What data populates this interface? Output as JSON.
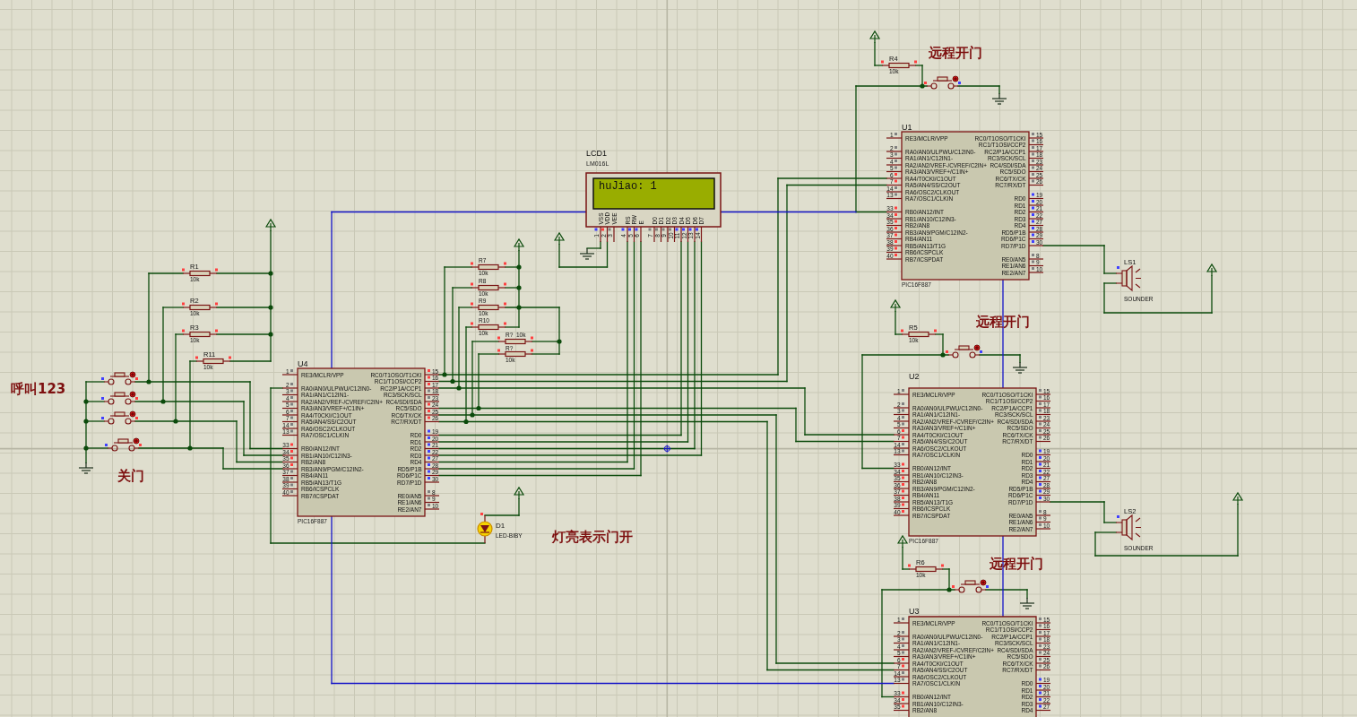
{
  "notes": [
    {
      "text": "远程开门"
    },
    {
      "text": "远程开门"
    },
    {
      "text": "呼叫123"
    },
    {
      "text": "关门"
    },
    {
      "text": "灯亮表示门开"
    },
    {
      "text": "远程开门"
    }
  ],
  "lcd": {
    "ref": "LCD1",
    "model": "LM016L",
    "display": "huJiao: 1",
    "pins": [
      {
        "name": "VSS",
        "number": "1",
        "color": "#4040ff"
      },
      {
        "name": "VDD",
        "number": "2",
        "color": "#ff4040"
      },
      {
        "name": "VEE",
        "number": "3",
        "color": "#808080"
      },
      {
        "name": "RS",
        "number": "4",
        "color": "#4040ff"
      },
      {
        "name": "RW",
        "number": "5",
        "color": "#4040ff"
      },
      {
        "name": "E",
        "number": "6",
        "color": "#4040ff"
      },
      {
        "name": "D0",
        "number": "7",
        "color": "#808080"
      },
      {
        "name": "D1",
        "number": "8",
        "color": "#808080"
      },
      {
        "name": "D2",
        "number": "9",
        "color": "#808080"
      },
      {
        "name": "D3",
        "number": "10",
        "color": "#808080"
      },
      {
        "name": "D4",
        "number": "11",
        "color": "#4040ff"
      },
      {
        "name": "D5",
        "number": "12",
        "color": "#4040ff"
      },
      {
        "name": "D6",
        "number": "13",
        "color": "#4040ff"
      },
      {
        "name": "D7",
        "number": "14",
        "color": "#4040ff"
      }
    ]
  },
  "chips": [
    {
      "ref": "U4",
      "model": "PIC16F887",
      "left_pins": [
        {
          "number": "1",
          "label": "RE3/MCLR/VPP",
          "color": "#808080"
        },
        {
          "number": "2",
          "label": "RA0/AN0/ULPWU/C12IN0-",
          "color": "#808080"
        },
        {
          "number": "3",
          "label": "RA1/AN1/C12IN1-",
          "color": "#808080"
        },
        {
          "number": "4",
          "label": "RA2/AN2/VREF-/CVREF/C2IN+",
          "color": "#808080"
        },
        {
          "number": "5",
          "label": "RA3/AN3/VREF+/C1IN+",
          "color": "#808080"
        },
        {
          "number": "6",
          "label": "RA4/T0CKI/C1OUT",
          "color": "#808080"
        },
        {
          "number": "7",
          "label": "RA5/AN4/SS/C2OUT",
          "color": "#808080"
        },
        {
          "number": "14",
          "label": "RA6/OSC2/CLKOUT",
          "color": "#808080"
        },
        {
          "number": "13",
          "label": "RA7/OSC1/CLKIN",
          "color": "#808080"
        },
        {
          "number": "33",
          "label": "RB0/AN12/INT",
          "color": "#ff4040"
        },
        {
          "number": "34",
          "label": "RB1/AN10/C12IN3-",
          "color": "#ff4040"
        },
        {
          "number": "35",
          "label": "RB2/AN8",
          "color": "#ff4040"
        },
        {
          "number": "36",
          "label": "RB3/AN9/PGM/C12IN2-",
          "color": "#ff4040"
        },
        {
          "number": "37",
          "label": "RB4/AN11",
          "color": "#808080"
        },
        {
          "number": "38",
          "label": "RB5/AN13/T1G",
          "color": "#808080"
        },
        {
          "number": "39",
          "label": "RB6/ICSPCLK",
          "color": "#808080"
        },
        {
          "number": "40",
          "label": "RB7/ICSPDAT",
          "color": "#808080"
        }
      ],
      "right_pins": [
        {
          "number": "15",
          "label": "RC0/T1OSO/T1CKI",
          "color": "#ff4040"
        },
        {
          "number": "16",
          "label": "RC1/T1OSI/CCP2",
          "color": "#ff4040"
        },
        {
          "number": "17",
          "label": "RC2/P1A/CCP1",
          "color": "#ff4040"
        },
        {
          "number": "18",
          "label": "RC3/SCK/SCL",
          "color": "#808080"
        },
        {
          "number": "23",
          "label": "RC4/SDI/SDA",
          "color": "#808080"
        },
        {
          "number": "24",
          "label": "RC5/SDO",
          "color": "#ff4040"
        },
        {
          "number": "25",
          "label": "RC6/TX/CK",
          "color": "#ff4040"
        },
        {
          "number": "26",
          "label": "RC7/RX/DT",
          "color": "#ff4040"
        },
        {
          "number": "19",
          "label": "RD0",
          "color": "#4040ff"
        },
        {
          "number": "20",
          "label": "RD1",
          "color": "#4040ff"
        },
        {
          "number": "21",
          "label": "RD2",
          "color": "#4040ff"
        },
        {
          "number": "22",
          "label": "RD3",
          "color": "#4040ff"
        },
        {
          "number": "27",
          "label": "RD4",
          "color": "#4040ff"
        },
        {
          "number": "28",
          "label": "RD5/P1B",
          "color": "#4040ff"
        },
        {
          "number": "29",
          "label": "RD6/P1C",
          "color": "#4040ff"
        },
        {
          "number": "30",
          "label": "RD7/P1D",
          "color": "#4040ff"
        },
        {
          "number": "8",
          "label": "RE0/AN5",
          "color": "#808080"
        },
        {
          "number": "9",
          "label": "RE1/AN6",
          "color": "#808080"
        },
        {
          "number": "10",
          "label": "RE2/AN7",
          "color": "#808080"
        }
      ]
    },
    {
      "ref": "U1",
      "model": "PIC16F887",
      "left_pins": [
        {
          "number": "1",
          "label": "RE3/MCLR/VPP",
          "color": "#808080"
        },
        {
          "number": "2",
          "label": "RA0/AN0/ULPWU/C12IN0-",
          "color": "#808080"
        },
        {
          "number": "3",
          "label": "RA1/AN1/C12IN1-",
          "color": "#808080"
        },
        {
          "number": "4",
          "label": "RA2/AN2/VREF-/CVREF/C2IN+",
          "color": "#808080"
        },
        {
          "number": "5",
          "label": "RA3/AN3/VREF+/C1IN+",
          "color": "#808080"
        },
        {
          "number": "6",
          "label": "RA4/T0CKI/C1OUT",
          "color": "#ff4040"
        },
        {
          "number": "7",
          "label": "RA5/AN4/SS/C2OUT",
          "color": "#ff4040"
        },
        {
          "number": "14",
          "label": "RA6/OSC2/CLKOUT",
          "color": "#808080"
        },
        {
          "number": "13",
          "label": "RA7/OSC1/CLKIN",
          "color": "#808080"
        },
        {
          "number": "33",
          "label": "RB0/AN12/INT",
          "color": "#ff4040"
        },
        {
          "number": "34",
          "label": "RB1/AN10/C12IN3-",
          "color": "#ff4040"
        },
        {
          "number": "35",
          "label": "RB2/AN8",
          "color": "#ff4040"
        },
        {
          "number": "36",
          "label": "RB3/AN9/PGM/C12IN2-",
          "color": "#ff4040"
        },
        {
          "number": "37",
          "label": "RB4/AN11",
          "color": "#ff4040"
        },
        {
          "number": "38",
          "label": "RB5/AN13/T1G",
          "color": "#ff4040"
        },
        {
          "number": "39",
          "label": "RB6/ICSPCLK",
          "color": "#ff4040"
        },
        {
          "number": "40",
          "label": "RB7/ICSPDAT",
          "color": "#ff4040"
        }
      ],
      "right_pins": [
        {
          "number": "15",
          "label": "RC0/T1OSO/T1CKI",
          "color": "#808080"
        },
        {
          "number": "16",
          "label": "RC1/T1OSI/CCP2",
          "color": "#808080"
        },
        {
          "number": "17",
          "label": "RC2/P1A/CCP1",
          "color": "#808080"
        },
        {
          "number": "18",
          "label": "RC3/SCK/SCL",
          "color": "#808080"
        },
        {
          "number": "23",
          "label": "RC4/SDI/SDA",
          "color": "#808080"
        },
        {
          "number": "24",
          "label": "RC5/SDO",
          "color": "#808080"
        },
        {
          "number": "25",
          "label": "RC6/TX/CK",
          "color": "#808080"
        },
        {
          "number": "26",
          "label": "RC7/RX/DT",
          "color": "#808080"
        },
        {
          "number": "19",
          "label": "RD0",
          "color": "#4040ff"
        },
        {
          "number": "20",
          "label": "RD1",
          "color": "#4040ff"
        },
        {
          "number": "21",
          "label": "RD2",
          "color": "#4040ff"
        },
        {
          "number": "22",
          "label": "RD3",
          "color": "#4040ff"
        },
        {
          "number": "27",
          "label": "RD4",
          "color": "#4040ff"
        },
        {
          "number": "28",
          "label": "RD5/P1B",
          "color": "#4040ff"
        },
        {
          "number": "29",
          "label": "RD6/P1C",
          "color": "#4040ff"
        },
        {
          "number": "30",
          "label": "RD7/P1D",
          "color": "#4040ff"
        },
        {
          "number": "8",
          "label": "RE0/AN5",
          "color": "#808080"
        },
        {
          "number": "9",
          "label": "RE1/AN6",
          "color": "#808080"
        },
        {
          "number": "10",
          "label": "RE2/AN7",
          "color": "#808080"
        }
      ]
    },
    {
      "ref": "U2",
      "model": "PIC16F887",
      "left_pins": [
        {
          "number": "1",
          "label": "RE3/MCLR/VPP",
          "color": "#808080"
        },
        {
          "number": "2",
          "label": "RA0/AN0/ULPWU/C12IN0-",
          "color": "#808080"
        },
        {
          "number": "3",
          "label": "RA1/AN1/C12IN1-",
          "color": "#808080"
        },
        {
          "number": "4",
          "label": "RA2/AN2/VREF-/CVREF/C2IN+",
          "color": "#808080"
        },
        {
          "number": "5",
          "label": "RA3/AN3/VREF+/C1IN+",
          "color": "#808080"
        },
        {
          "number": "6",
          "label": "RA4/T0CKI/C1OUT",
          "color": "#ff4040"
        },
        {
          "number": "7",
          "label": "RA5/AN4/SS/C2OUT",
          "color": "#ff4040"
        },
        {
          "number": "14",
          "label": "RA6/OSC2/CLKOUT",
          "color": "#808080"
        },
        {
          "number": "13",
          "label": "RA7/OSC1/CLKIN",
          "color": "#808080"
        },
        {
          "number": "33",
          "label": "RB0/AN12/INT",
          "color": "#ff4040"
        },
        {
          "number": "34",
          "label": "RB1/AN10/C12IN3-",
          "color": "#ff4040"
        },
        {
          "number": "35",
          "label": "RB2/AN8",
          "color": "#ff4040"
        },
        {
          "number": "36",
          "label": "RB3/AN9/PGM/C12IN2-",
          "color": "#ff4040"
        },
        {
          "number": "37",
          "label": "RB4/AN11",
          "color": "#ff4040"
        },
        {
          "number": "38",
          "label": "RB5/AN13/T1G",
          "color": "#ff4040"
        },
        {
          "number": "39",
          "label": "RB6/ICSPCLK",
          "color": "#ff4040"
        },
        {
          "number": "40",
          "label": "RB7/ICSPDAT",
          "color": "#ff4040"
        }
      ],
      "right_pins": [
        {
          "number": "15",
          "label": "RC0/T1OSO/T1CKI",
          "color": "#808080"
        },
        {
          "number": "16",
          "label": "RC1/T1OSI/CCP2",
          "color": "#808080"
        },
        {
          "number": "17",
          "label": "RC2/P1A/CCP1",
          "color": "#808080"
        },
        {
          "number": "18",
          "label": "RC3/SCK/SCL",
          "color": "#808080"
        },
        {
          "number": "23",
          "label": "RC4/SDI/SDA",
          "color": "#808080"
        },
        {
          "number": "24",
          "label": "RC5/SDO",
          "color": "#808080"
        },
        {
          "number": "25",
          "label": "RC6/TX/CK",
          "color": "#808080"
        },
        {
          "number": "26",
          "label": "RC7/RX/DT",
          "color": "#808080"
        },
        {
          "number": "19",
          "label": "RD0",
          "color": "#4040ff"
        },
        {
          "number": "20",
          "label": "RD1",
          "color": "#4040ff"
        },
        {
          "number": "21",
          "label": "RD2",
          "color": "#4040ff"
        },
        {
          "number": "22",
          "label": "RD3",
          "color": "#4040ff"
        },
        {
          "number": "27",
          "label": "RD4",
          "color": "#4040ff"
        },
        {
          "number": "28",
          "label": "RD5/P1B",
          "color": "#4040ff"
        },
        {
          "number": "29",
          "label": "RD6/P1C",
          "color": "#4040ff"
        },
        {
          "number": "30",
          "label": "RD7/P1D",
          "color": "#4040ff"
        },
        {
          "number": "8",
          "label": "RE0/AN5",
          "color": "#808080"
        },
        {
          "number": "9",
          "label": "RE1/AN6",
          "color": "#808080"
        },
        {
          "number": "10",
          "label": "RE2/AN7",
          "color": "#808080"
        }
      ]
    },
    {
      "ref": "U3",
      "left_pins": [
        {
          "number": "1",
          "label": "RE3/MCLR/VPP",
          "color": "#808080"
        },
        {
          "number": "2",
          "label": "RA0/AN0/ULPWU/C12IN0-",
          "color": "#808080"
        },
        {
          "number": "3",
          "label": "RA1/AN1/C12IN1-",
          "color": "#808080"
        },
        {
          "number": "4",
          "label": "RA2/AN2/VREF-/CVREF/C2IN+",
          "color": "#808080"
        },
        {
          "number": "5",
          "label": "RA3/AN3/VREF+/C1IN+",
          "color": "#808080"
        },
        {
          "number": "6",
          "label": "RA4/T0CKI/C1OUT",
          "color": "#ff4040"
        },
        {
          "number": "7",
          "label": "RA5/AN4/SS/C2OUT",
          "color": "#ff4040"
        },
        {
          "number": "14",
          "label": "RA6/OSC2/CLKOUT",
          "color": "#808080"
        },
        {
          "number": "13",
          "label": "RA7/OSC1/CLKIN",
          "color": "#808080"
        },
        {
          "number": "33",
          "label": "RB0/AN12/INT",
          "color": "#ff4040"
        },
        {
          "number": "34",
          "label": "RB1/AN10/C12IN3-",
          "color": "#ff4040"
        },
        {
          "number": "35",
          "label": "RB2/AN8",
          "color": "#ff4040"
        }
      ],
      "right_pins": [
        {
          "number": "15",
          "label": "RC0/T1OSO/T1CKI",
          "color": "#808080"
        },
        {
          "number": "16",
          "label": "RC1/T1OSI/CCP2",
          "color": "#808080"
        },
        {
          "number": "17",
          "label": "RC2/P1A/CCP1",
          "color": "#808080"
        },
        {
          "number": "18",
          "label": "RC3/SCK/SCL",
          "color": "#808080"
        },
        {
          "number": "23",
          "label": "RC4/SDI/SDA",
          "color": "#808080"
        },
        {
          "number": "24",
          "label": "RC5/SDO",
          "color": "#808080"
        },
        {
          "number": "25",
          "label": "RC6/TX/CK",
          "color": "#808080"
        },
        {
          "number": "26",
          "label": "RC7/RX/DT",
          "color": "#808080"
        },
        {
          "number": "19",
          "label": "RD0",
          "color": "#4040ff"
        },
        {
          "number": "20",
          "label": "RD1",
          "color": "#4040ff"
        },
        {
          "number": "21",
          "label": "RD2",
          "color": "#4040ff"
        },
        {
          "number": "22",
          "label": "RD3",
          "color": "#4040ff"
        },
        {
          "number": "27",
          "label": "RD4",
          "color": "#4040ff"
        }
      ]
    }
  ],
  "resistors": [
    {
      "ref": "R1",
      "value": "10k",
      "pins": [
        {
          "color": "#ff4040"
        },
        {
          "color": "#ff4040"
        }
      ]
    },
    {
      "ref": "R2",
      "value": "10k",
      "pins": [
        {
          "color": "#ff4040"
        },
        {
          "color": "#ff4040"
        }
      ]
    },
    {
      "ref": "R3",
      "value": "10k",
      "pins": [
        {
          "color": "#ff4040"
        },
        {
          "color": "#ff4040"
        }
      ]
    },
    {
      "ref": "R11",
      "value": "10k",
      "pins": [
        {
          "color": "#ff4040"
        },
        {
          "color": "#ff4040"
        }
      ]
    },
    {
      "ref": "R7",
      "value": "10k",
      "pins": [
        {
          "color": "#ff4040"
        },
        {
          "color": "#ff4040"
        }
      ]
    },
    {
      "ref": "R8",
      "value": "10k",
      "pins": [
        {
          "color": "#ff4040"
        },
        {
          "color": "#ff4040"
        }
      ]
    },
    {
      "ref": "R9",
      "value": "10k",
      "pins": [
        {
          "color": "#ff4040"
        },
        {
          "color": "#ff4040"
        }
      ]
    },
    {
      "ref": "R10",
      "value": "10k",
      "pins": [
        {
          "color": "#ff4040"
        },
        {
          "color": "#ff4040"
        }
      ]
    },
    {
      "ref": "R?",
      "value": "10k",
      "pins": [
        {
          "color": "#ff4040"
        },
        {
          "color": "#ff4040"
        }
      ]
    },
    {
      "ref": "R?",
      "value": "10k",
      "pins": [
        {
          "color": "#ff4040"
        },
        {
          "color": "#ff4040"
        }
      ]
    },
    {
      "ref": "R4",
      "value": "10k",
      "pins": [
        {
          "color": "#ff4040"
        },
        {
          "color": "#ff4040"
        }
      ]
    },
    {
      "ref": "R5",
      "value": "10k",
      "pins": [
        {
          "color": "#ff4040"
        },
        {
          "color": "#ff4040"
        }
      ]
    },
    {
      "ref": "R6",
      "value": "10k",
      "pins": [
        {
          "color": "#ff4040"
        },
        {
          "color": "#ff4040"
        }
      ]
    }
  ],
  "switches": [
    {
      "pressed": false,
      "pins": [
        {
          "color": "#4040ff"
        },
        {
          "color": "#ff4040"
        }
      ]
    },
    {
      "pressed": false,
      "pins": [
        {
          "color": "#4040ff"
        },
        {
          "color": "#ff4040"
        }
      ]
    },
    {
      "pressed": false,
      "pins": [
        {
          "color": "#4040ff"
        },
        {
          "color": "#ff4040"
        }
      ]
    },
    {
      "pressed": false,
      "pins": [
        {
          "color": "#4040ff"
        },
        {
          "color": "#ff4040"
        }
      ]
    },
    {
      "pressed": false,
      "pins": [
        {
          "color": "#ff4040"
        },
        {
          "color": "#4040ff"
        }
      ]
    },
    {
      "pressed": false,
      "pins": [
        {
          "color": "#ff4040"
        },
        {
          "color": "#4040ff"
        }
      ]
    },
    {
      "pressed": false,
      "pins": [
        {
          "color": "#ff4040"
        },
        {
          "color": "#4040ff"
        }
      ]
    }
  ],
  "led": {
    "ref": "D1",
    "model": "LED-BIBY",
    "lit": true,
    "pins": [
      {
        "color": "#ff4040"
      }
    ]
  },
  "sounders": [
    {
      "ref": "LS1",
      "model": "SOUNDER",
      "pins": [
        {
          "color": "#4040ff"
        }
      ]
    },
    {
      "ref": "LS2",
      "model": "SOUNDER",
      "pins": [
        {
          "color": "#4040ff"
        }
      ]
    }
  ]
}
